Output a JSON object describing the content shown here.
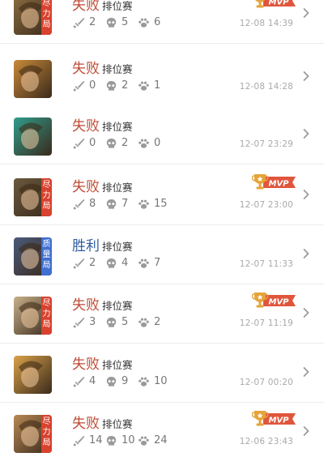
{
  "matches": [
    {
      "result": "失败",
      "outcome": "lose",
      "mode": "排位赛",
      "kills": "2",
      "deaths": "5",
      "assists": "6",
      "time": "12-08 14:39",
      "mvp": true,
      "badge": "尽力局",
      "badge_color": "#d8422e",
      "avatar_color": "#8a6b3f"
    },
    {
      "result": "失败",
      "outcome": "lose",
      "mode": "排位赛",
      "kills": "0",
      "deaths": "2",
      "assists": "1",
      "time": "12-08 14:28",
      "mvp": false,
      "badge": "",
      "badge_color": "",
      "avatar_color": "#c98a3a"
    },
    {
      "result": "失败",
      "outcome": "lose",
      "mode": "排位赛",
      "kills": "0",
      "deaths": "2",
      "assists": "0",
      "time": "12-07 23:29",
      "mvp": false,
      "badge": "",
      "badge_color": "",
      "avatar_color": "#2f9c8c"
    },
    {
      "result": "失败",
      "outcome": "lose",
      "mode": "排位赛",
      "kills": "8",
      "deaths": "7",
      "assists": "15",
      "time": "12-07 23:00",
      "mvp": true,
      "badge": "尽力局",
      "badge_color": "#d8422e",
      "avatar_color": "#6b5a3e"
    },
    {
      "result": "胜利",
      "outcome": "win",
      "mode": "排位赛",
      "kills": "2",
      "deaths": "4",
      "assists": "7",
      "time": "12-07 11:33",
      "mvp": false,
      "badge": "质量局",
      "badge_color": "#3f6fd0",
      "avatar_color": "#4a5a7a"
    },
    {
      "result": "失败",
      "outcome": "lose",
      "mode": "排位赛",
      "kills": "3",
      "deaths": "5",
      "assists": "2",
      "time": "12-07 11:19",
      "mvp": true,
      "badge": "尽力局",
      "badge_color": "#d8422e",
      "avatar_color": "#c7b08a"
    },
    {
      "result": "失败",
      "outcome": "lose",
      "mode": "排位赛",
      "kills": "4",
      "deaths": "9",
      "assists": "10",
      "time": "12-07 00:20",
      "mvp": false,
      "badge": "",
      "badge_color": "",
      "avatar_color": "#d9a24a"
    },
    {
      "result": "失败",
      "outcome": "lose",
      "mode": "排位赛",
      "kills": "14",
      "deaths": "10",
      "assists": "24",
      "time": "12-06 23:43",
      "mvp": true,
      "badge": "尽力局",
      "badge_color": "#d8422e",
      "avatar_color": "#b88955"
    }
  ],
  "mvp_label": "MVP",
  "icons": {
    "kills": "sword-icon",
    "deaths": "skull-icon",
    "assists": "paw-icon",
    "chevron": "chevron-right-icon",
    "mvp": "trophy-icon"
  },
  "colors": {
    "lose": "#c04a34",
    "win": "#2f5d9e",
    "mvp_banner": "#e0563c",
    "mvp_trophy": "#e5a43a"
  }
}
